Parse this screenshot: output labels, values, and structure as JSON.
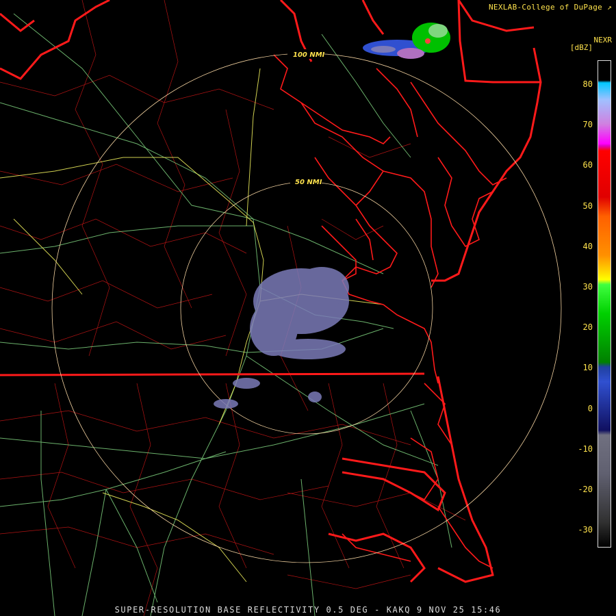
{
  "credit": "NEXLAB-College of DuPage",
  "legend": {
    "title": "NEXR",
    "unit": "[dBZ]",
    "ticks": [
      "80",
      "70",
      "60",
      "50",
      "40",
      "30",
      "20",
      "10",
      "0",
      "-10",
      "-20",
      "-30"
    ],
    "colors": {
      "high": "#00c8ff",
      "magenta": "#ff00ff",
      "red": "#ff0000",
      "orange": "#ff8000",
      "yellow": "#ffff00",
      "green": "#00c000",
      "blue": "#3050d0",
      "gray": "#707080"
    }
  },
  "range_rings": [
    "100 NMI",
    "50 NMI"
  ],
  "footer": "SUPER-RESOLUTION BASE REFLECTIVITY 0.5 DEG - KAKQ 9 NOV 25 15:46",
  "map_colors": {
    "state_border": "#ff1a1a",
    "county": "#e02020",
    "highway_green": "#7fd27f",
    "highway_yellow": "#e8e85a",
    "ring": "#f3d2a0",
    "echo": "#7b7bb8"
  }
}
